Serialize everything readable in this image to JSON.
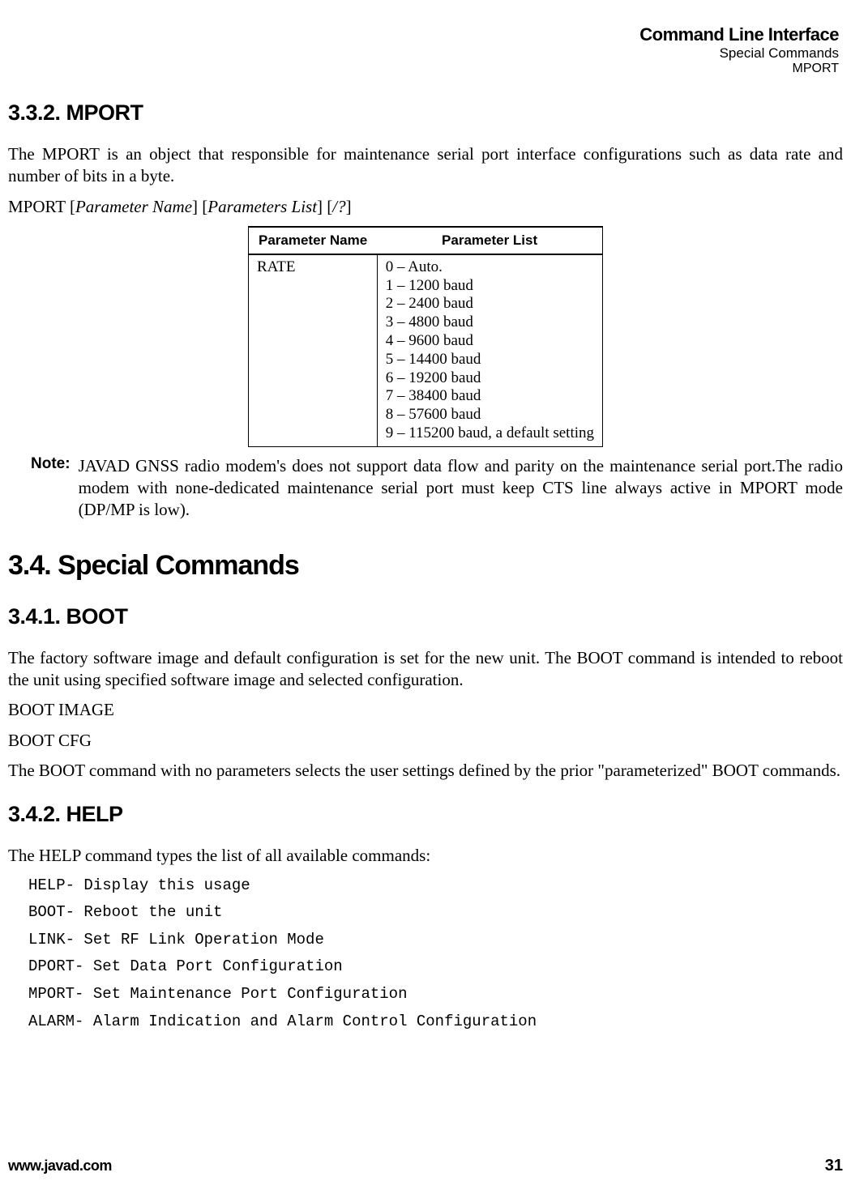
{
  "header": {
    "title": "Command Line Interface",
    "sub1": "Special Commands",
    "sub2": "MPORT"
  },
  "s332": {
    "heading": "3.3.2. MPORT",
    "p1": "The MPORT is an object that responsible for maintenance serial port interface configurations such as data rate and number of bits in a byte.",
    "p2_pre": "MPORT [",
    "p2_i1": "Parameter Name",
    "p2_mid1": "] [",
    "p2_i2": "Parameters List",
    "p2_mid2": "] [",
    "p2_i3": "/?",
    "p2_post": "]"
  },
  "table": {
    "h1": "Parameter Name",
    "h2": "Parameter List",
    "r1c1": "RATE",
    "r1c2_0": "0 – Auto.",
    "r1c2_1": "1 – 1200 baud",
    "r1c2_2": "2 – 2400 baud",
    "r1c2_3": "3 – 4800 baud",
    "r1c2_4": "4 – 9600 baud",
    "r1c2_5": "5 – 14400 baud",
    "r1c2_6": "6 – 19200 baud",
    "r1c2_7": "7 – 38400 baud",
    "r1c2_8": "8 – 57600 baud",
    "r1c2_9": "9 – 115200 baud, a default setting"
  },
  "note": {
    "label": "Note:",
    "body": "JAVAD GNSS radio modem's does not support data flow and parity on the maintenance serial port.The radio modem with none-dedicated maintenance serial port must keep CTS line always active in MPORT mode (DP/MP is low)."
  },
  "s34": {
    "heading": "3.4. Special Commands"
  },
  "s341": {
    "heading": "3.4.1. BOOT",
    "p1": "The factory software image and default configuration is set for the new unit. The BOOT command is intended to reboot the unit using specified software image and selected configuration.",
    "p2": "BOOT IMAGE",
    "p3": "BOOT CFG",
    "p4": "The BOOT command with no parameters selects the user settings defined by the prior \"parameterized\" BOOT commands."
  },
  "s342": {
    "heading": "3.4.2. HELP",
    "p1": "The HELP command types the list of all available commands:",
    "m1": "HELP- Display this usage",
    "m2": "BOOT- Reboot the unit",
    "m3": "LINK- Set RF Link Operation Mode",
    "m4": "DPORT- Set Data Port Configuration",
    "m5": "MPORT- Set Maintenance Port Configuration",
    "m6": "ALARM- Alarm Indication and Alarm Control Configuration"
  },
  "footer": {
    "url": "www.javad.com",
    "page": "31"
  }
}
